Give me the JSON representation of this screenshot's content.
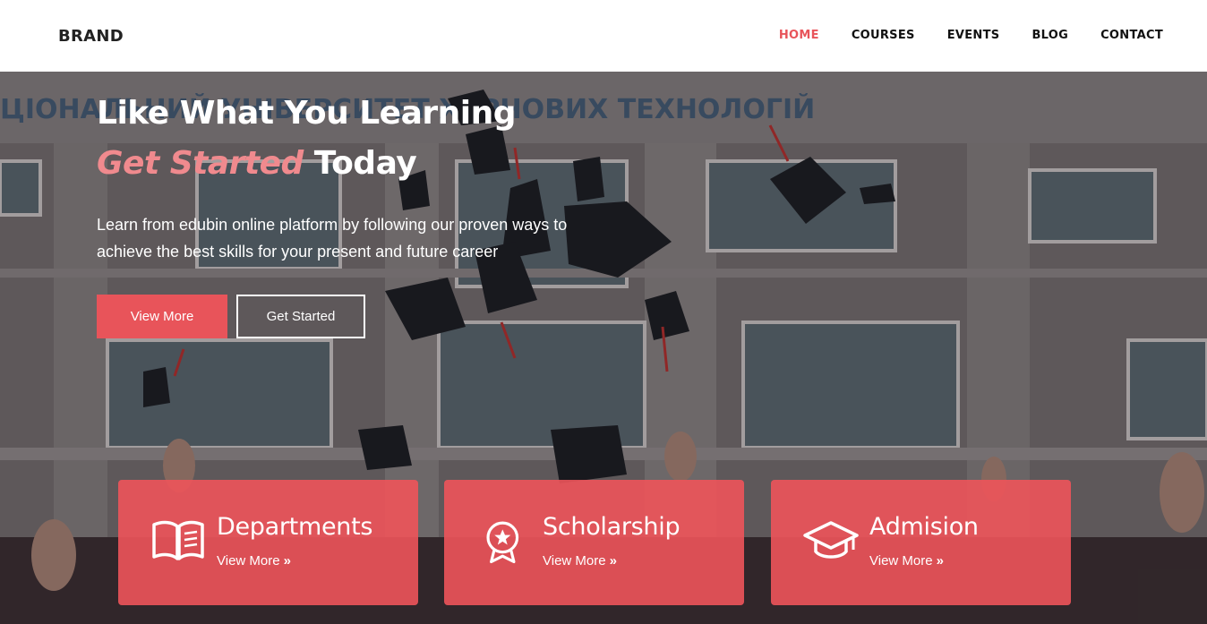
{
  "brand": "BRAND",
  "nav": {
    "items": [
      {
        "label": "HOME",
        "active": true
      },
      {
        "label": "COURSES",
        "active": false
      },
      {
        "label": "EVENTS",
        "active": false
      },
      {
        "label": "BLOG",
        "active": false
      },
      {
        "label": "CONTACT",
        "active": false
      }
    ]
  },
  "hero": {
    "headline_line1": "Like What You Learning",
    "headline_accent": "Get Started",
    "headline_rest": "Today",
    "description": "Learn from edubin online platform by following our proven ways to achieve the best skills for your present and future career",
    "primary_button": "View More",
    "secondary_button": "Get Started",
    "banner_text": "ЦІОНАЛЬНИЙ УНІВЕРСИТЕТ ХАРЧОВИХ ТЕХНОЛОГІЙ"
  },
  "cards": [
    {
      "title": "Departments",
      "link": "View More",
      "icon": "open-book-icon"
    },
    {
      "title": "Scholarship",
      "link": "View More",
      "icon": "award-medal-icon"
    },
    {
      "title": "Admision",
      "link": "View More",
      "icon": "graduation-cap-icon"
    }
  ],
  "colors": {
    "accent": "#e8545a",
    "accent_light": "#f08a8e",
    "card": "#ee545a"
  }
}
